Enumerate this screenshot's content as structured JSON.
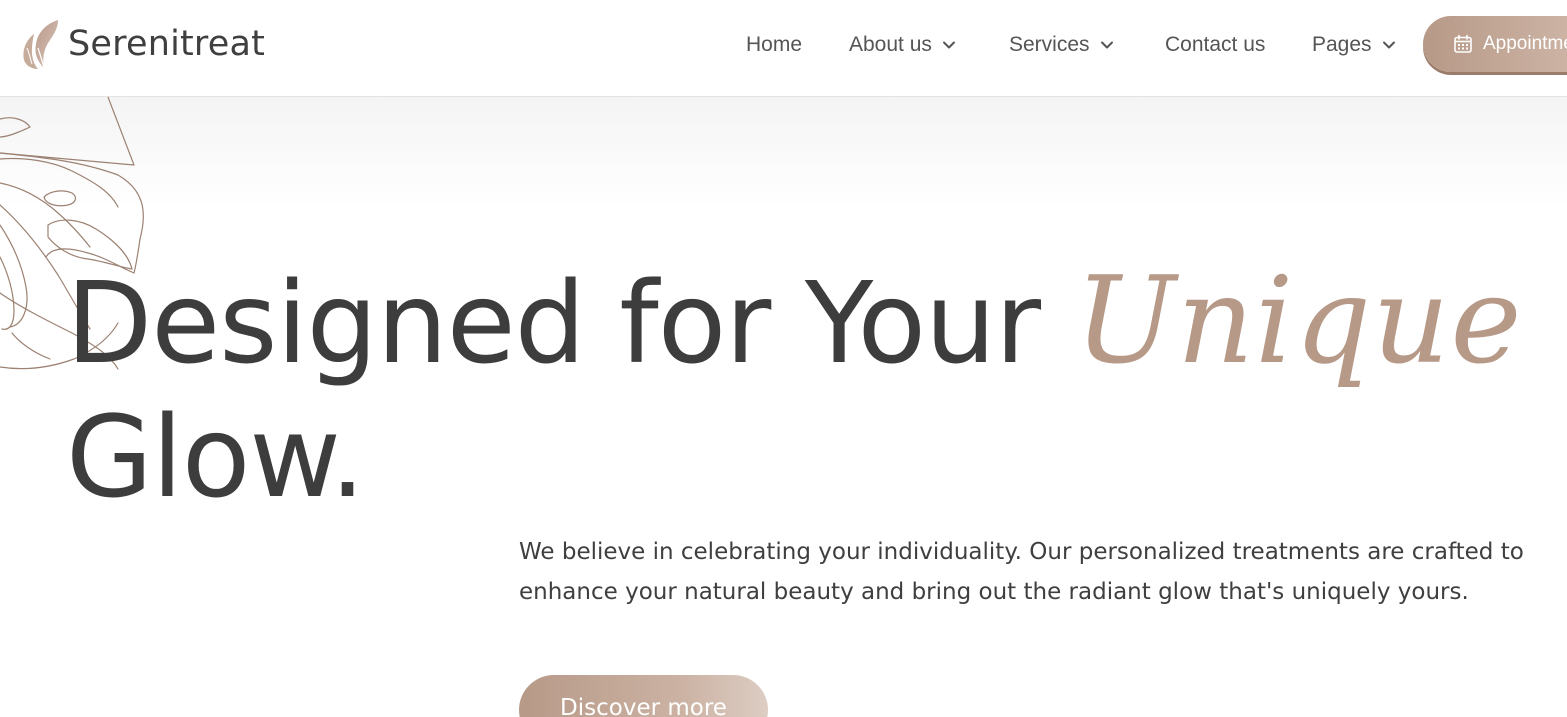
{
  "brand": {
    "name": "Serenitreat",
    "accent_color": "#b79987",
    "text_color": "#3d3d3d",
    "logo_icon": "leaf-face-logo"
  },
  "nav": {
    "items": [
      {
        "label": "Home",
        "has_dropdown": false
      },
      {
        "label": "About us",
        "has_dropdown": true
      },
      {
        "label": "Services",
        "has_dropdown": true
      },
      {
        "label": "Contact us",
        "has_dropdown": false
      },
      {
        "label": "Pages",
        "has_dropdown": true
      }
    ],
    "cta": {
      "label": "Appointment",
      "icon": "calendar-icon"
    }
  },
  "hero": {
    "headline_part1": "Designed for Your ",
    "headline_accent": "Unique",
    "headline_part2": "Glow.",
    "description": "We believe in celebrating your individuality. Our personalized treatments are crafted to enhance your natural beauty and bring out the radiant glow that's uniquely yours.",
    "button_label": "Discover more"
  }
}
